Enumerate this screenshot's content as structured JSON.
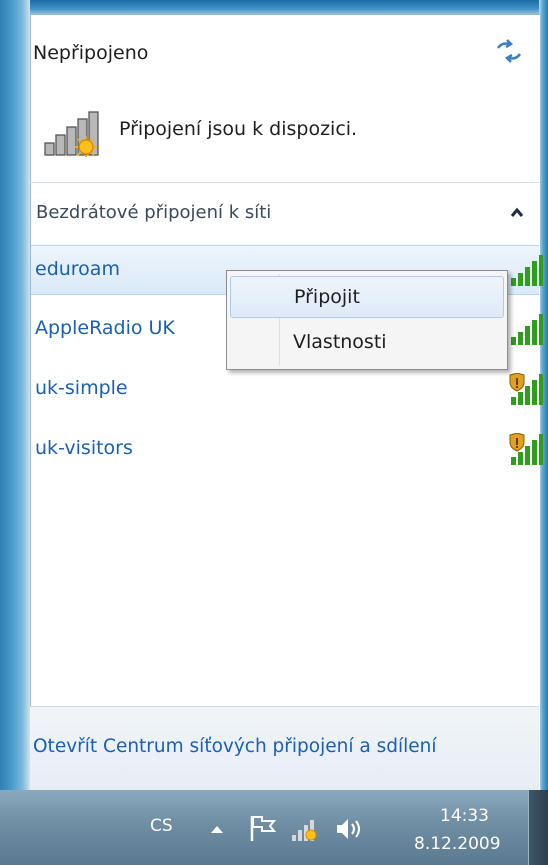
{
  "header": {
    "status_title": "Nepřipojeno",
    "status_text": "Připojení jsou k dispozici."
  },
  "section": {
    "label": "Bezdrátové připojení k síti"
  },
  "networks": [
    {
      "name": "eduroam",
      "secured": false,
      "selected": true
    },
    {
      "name": "AppleRadio UK",
      "secured": false,
      "selected": false
    },
    {
      "name": "uk-simple",
      "secured": true,
      "selected": false
    },
    {
      "name": "uk-visitors",
      "secured": true,
      "selected": false
    }
  ],
  "context_menu": {
    "items": [
      {
        "label": "Připojit",
        "hover": true
      },
      {
        "label": "Vlastnosti",
        "hover": false
      }
    ]
  },
  "footer": {
    "link": "Otevřít Centrum síťových připojení a sdílení"
  },
  "taskbar": {
    "language": "CS",
    "time": "14:33",
    "date": "8.12.2009"
  },
  "colors": {
    "link": "#1a5fb4",
    "signal_bars": "#2f9e1f",
    "shield": "#e0a020"
  },
  "icons": [
    "refresh-icon",
    "network-status-icon",
    "collapse-chevron-icon",
    "signal-strength-icon",
    "security-shield-icon",
    "show-hidden-icons-arrow",
    "action-center-flag-icon",
    "network-tray-icon",
    "volume-icon"
  ]
}
